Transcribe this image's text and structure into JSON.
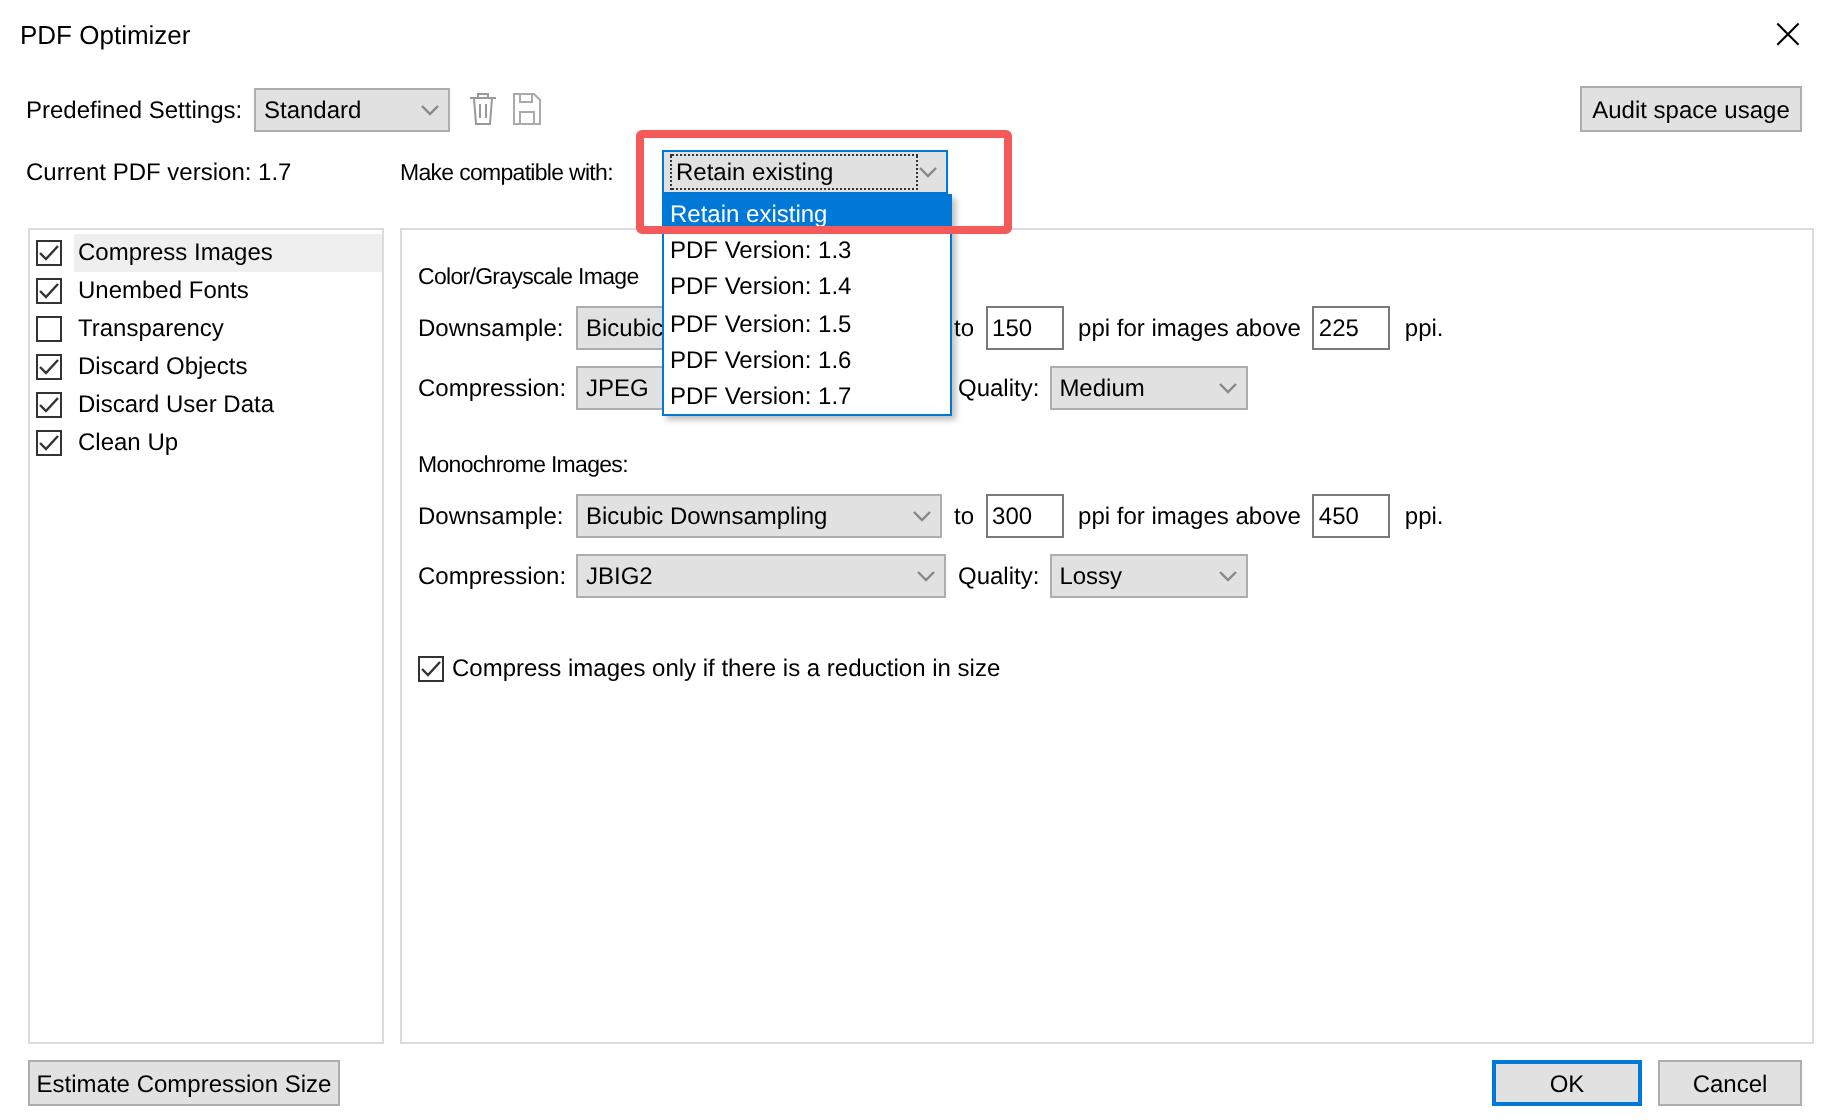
{
  "window": {
    "title": "PDF Optimizer",
    "close": "×"
  },
  "predefined": {
    "label": "Predefined Settings:",
    "value": "Standard"
  },
  "audit_button": "Audit space usage",
  "current_version": "Current PDF version: 1.7",
  "compatible": {
    "label": "Make compatible with:",
    "value": "Retain existing",
    "expanded": true,
    "options": [
      {
        "label": "Retain existing",
        "selected": true
      },
      {
        "label": "PDF Version: 1.3",
        "selected": false
      },
      {
        "label": "PDF Version: 1.4",
        "selected": false
      },
      {
        "label": "PDF Version: 1.5",
        "selected": false
      },
      {
        "label": "PDF Version: 1.6",
        "selected": false
      },
      {
        "label": "PDF Version: 1.7",
        "selected": false
      }
    ]
  },
  "panels": [
    {
      "label": "Compress Images",
      "checked": true,
      "selected": true
    },
    {
      "label": "Unembed Fonts",
      "checked": true,
      "selected": false
    },
    {
      "label": "Transparency",
      "checked": false,
      "selected": false
    },
    {
      "label": "Discard Objects",
      "checked": true,
      "selected": false
    },
    {
      "label": "Discard User Data",
      "checked": true,
      "selected": false
    },
    {
      "label": "Clean Up",
      "checked": true,
      "selected": false
    }
  ],
  "image_sections": [
    {
      "heading": "Color/Grayscale Image",
      "arrows_covered": true,
      "downsample_label": "Downsample:",
      "downsample": "Bicubic",
      "to": "to",
      "ppi": "150",
      "ppi_text": "ppi  for images above",
      "above": "225",
      "ppi_end": "ppi.",
      "compression_label": "Compression:",
      "compression": "JPEG",
      "quality_label": "Quality:",
      "quality": "Medium"
    },
    {
      "heading": "Monochrome Images:",
      "arrows_covered": false,
      "downsample_label": "Downsample:",
      "downsample": "Bicubic Downsampling",
      "to": "to",
      "ppi": "300",
      "ppi_text": "ppi  for images above",
      "above": "450",
      "ppi_end": "ppi.",
      "compression_label": "Compression:",
      "compression": "JBIG2",
      "quality_label": "Quality:",
      "quality": "Lossy"
    }
  ],
  "compress_only": {
    "label": "Compress images only if there is a reduction in size",
    "checked": true
  },
  "buttons": {
    "estimate": "Estimate Compression Size",
    "ok": "OK",
    "cancel": "Cancel"
  }
}
